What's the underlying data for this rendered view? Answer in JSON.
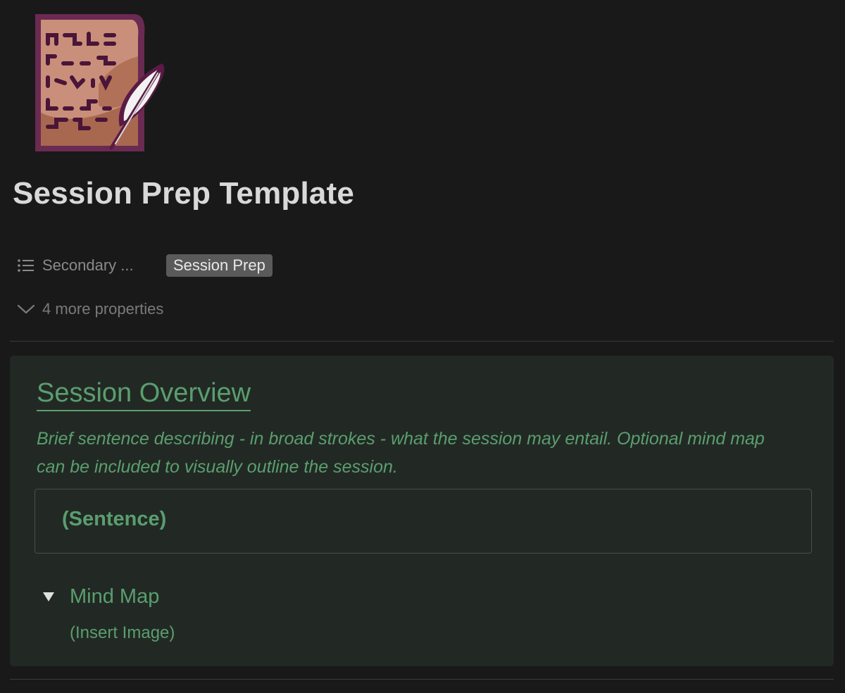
{
  "page": {
    "icon": "scroll-with-quill-icon",
    "title": "Session Prep Template"
  },
  "properties": {
    "row": {
      "icon": "list-icon",
      "name": "Secondary ...",
      "tag": "Session Prep"
    },
    "more": {
      "icon": "chevron-down-icon",
      "label": "4 more properties"
    }
  },
  "callout": {
    "heading": "Session Overview",
    "description": "Brief sentence describing - in broad strokes - what the session may entail. Optional mind map can be included to visually outline the session.",
    "sentence_placeholder": "(Sentence)",
    "toggle": {
      "icon": "triangle-down-icon",
      "title": "Mind Map",
      "content": "(Insert Image)"
    }
  },
  "colors": {
    "background": "#191919",
    "callout_background": "#222924",
    "accent_green": "#5a9e6f",
    "tag_background": "#5a5a5a",
    "muted_text": "#8a8a8a"
  }
}
